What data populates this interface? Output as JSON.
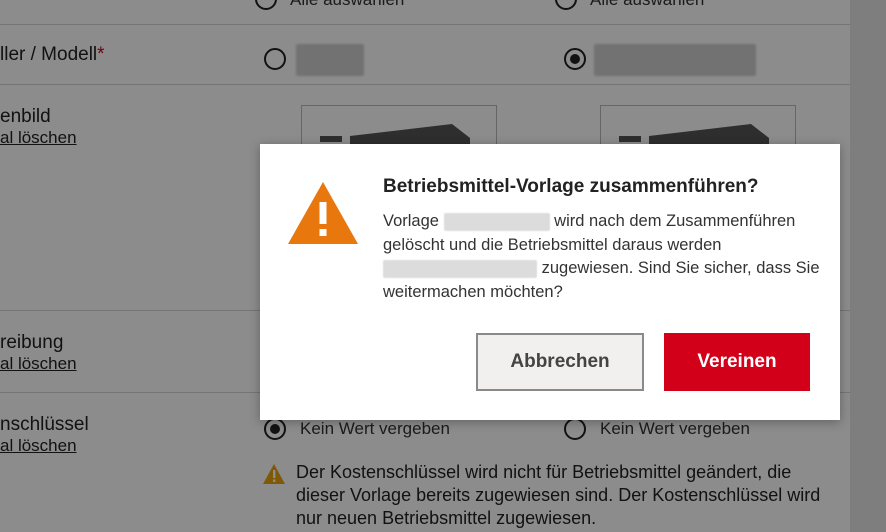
{
  "form": {
    "select_all_left": "Alle auswählen",
    "select_all_right": "Alle auswählen",
    "row_model_label": "ller / Modell",
    "row_model_required": "*",
    "row_image_label": "enbild",
    "row_image_link": "al löschen",
    "row_desc_label": "reibung",
    "row_desc_link": "al löschen",
    "row_cost_label": "nschlüssel",
    "row_cost_link": "al löschen",
    "cost_option_left": "Kein Wert vergeben",
    "cost_option_right": "Kein Wert vergeben",
    "cost_note": "Der Kostenschlüssel wird nicht für Betriebsmittel geändert, die dieser Vorlage bereits zugewiesen sind. Der Kostenschlüssel wird nur neuen Betriebsmittel zugewiesen."
  },
  "dialog": {
    "title": "Betriebsmittel-Vorlage zusammenführen?",
    "body_part1": "Vorlage",
    "body_part2": "wird nach dem Zusammenführen gelöscht und die Betriebsmittel daraus werden",
    "body_part3": "zugewiesen. Sind Sie sicher, dass Sie weitermachen möchten?",
    "cancel_label": "Abbrechen",
    "merge_label": "Vereinen",
    "icon": "warning-icon"
  },
  "colors": {
    "accent_red": "#d30019",
    "warning_orange": "#e8770d",
    "required_red": "#d0021b"
  }
}
